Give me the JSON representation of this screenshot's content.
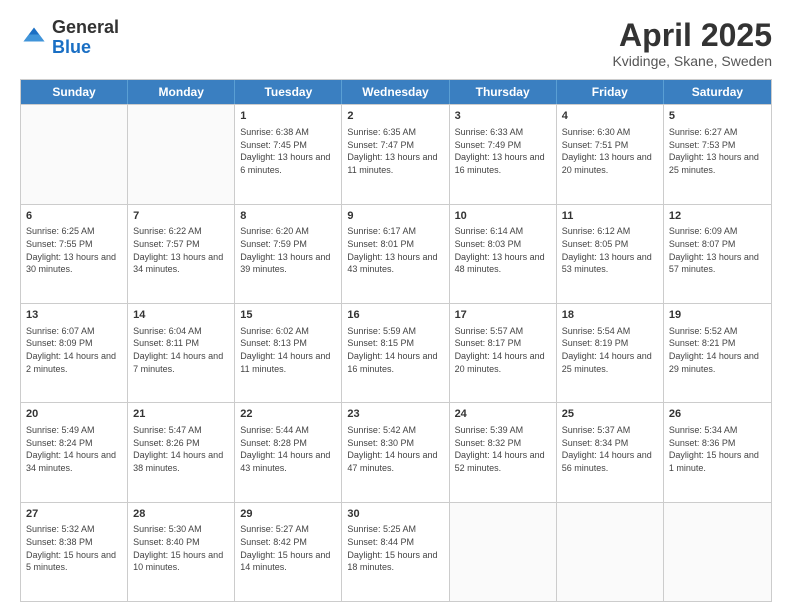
{
  "header": {
    "logo_general": "General",
    "logo_blue": "Blue",
    "month_title": "April 2025",
    "subtitle": "Kvidinge, Skane, Sweden"
  },
  "weekdays": [
    "Sunday",
    "Monday",
    "Tuesday",
    "Wednesday",
    "Thursday",
    "Friday",
    "Saturday"
  ],
  "weeks": [
    [
      {
        "day": "",
        "info": ""
      },
      {
        "day": "",
        "info": ""
      },
      {
        "day": "1",
        "info": "Sunrise: 6:38 AM\nSunset: 7:45 PM\nDaylight: 13 hours and 6 minutes."
      },
      {
        "day": "2",
        "info": "Sunrise: 6:35 AM\nSunset: 7:47 PM\nDaylight: 13 hours and 11 minutes."
      },
      {
        "day": "3",
        "info": "Sunrise: 6:33 AM\nSunset: 7:49 PM\nDaylight: 13 hours and 16 minutes."
      },
      {
        "day": "4",
        "info": "Sunrise: 6:30 AM\nSunset: 7:51 PM\nDaylight: 13 hours and 20 minutes."
      },
      {
        "day": "5",
        "info": "Sunrise: 6:27 AM\nSunset: 7:53 PM\nDaylight: 13 hours and 25 minutes."
      }
    ],
    [
      {
        "day": "6",
        "info": "Sunrise: 6:25 AM\nSunset: 7:55 PM\nDaylight: 13 hours and 30 minutes."
      },
      {
        "day": "7",
        "info": "Sunrise: 6:22 AM\nSunset: 7:57 PM\nDaylight: 13 hours and 34 minutes."
      },
      {
        "day": "8",
        "info": "Sunrise: 6:20 AM\nSunset: 7:59 PM\nDaylight: 13 hours and 39 minutes."
      },
      {
        "day": "9",
        "info": "Sunrise: 6:17 AM\nSunset: 8:01 PM\nDaylight: 13 hours and 43 minutes."
      },
      {
        "day": "10",
        "info": "Sunrise: 6:14 AM\nSunset: 8:03 PM\nDaylight: 13 hours and 48 minutes."
      },
      {
        "day": "11",
        "info": "Sunrise: 6:12 AM\nSunset: 8:05 PM\nDaylight: 13 hours and 53 minutes."
      },
      {
        "day": "12",
        "info": "Sunrise: 6:09 AM\nSunset: 8:07 PM\nDaylight: 13 hours and 57 minutes."
      }
    ],
    [
      {
        "day": "13",
        "info": "Sunrise: 6:07 AM\nSunset: 8:09 PM\nDaylight: 14 hours and 2 minutes."
      },
      {
        "day": "14",
        "info": "Sunrise: 6:04 AM\nSunset: 8:11 PM\nDaylight: 14 hours and 7 minutes."
      },
      {
        "day": "15",
        "info": "Sunrise: 6:02 AM\nSunset: 8:13 PM\nDaylight: 14 hours and 11 minutes."
      },
      {
        "day": "16",
        "info": "Sunrise: 5:59 AM\nSunset: 8:15 PM\nDaylight: 14 hours and 16 minutes."
      },
      {
        "day": "17",
        "info": "Sunrise: 5:57 AM\nSunset: 8:17 PM\nDaylight: 14 hours and 20 minutes."
      },
      {
        "day": "18",
        "info": "Sunrise: 5:54 AM\nSunset: 8:19 PM\nDaylight: 14 hours and 25 minutes."
      },
      {
        "day": "19",
        "info": "Sunrise: 5:52 AM\nSunset: 8:21 PM\nDaylight: 14 hours and 29 minutes."
      }
    ],
    [
      {
        "day": "20",
        "info": "Sunrise: 5:49 AM\nSunset: 8:24 PM\nDaylight: 14 hours and 34 minutes."
      },
      {
        "day": "21",
        "info": "Sunrise: 5:47 AM\nSunset: 8:26 PM\nDaylight: 14 hours and 38 minutes."
      },
      {
        "day": "22",
        "info": "Sunrise: 5:44 AM\nSunset: 8:28 PM\nDaylight: 14 hours and 43 minutes."
      },
      {
        "day": "23",
        "info": "Sunrise: 5:42 AM\nSunset: 8:30 PM\nDaylight: 14 hours and 47 minutes."
      },
      {
        "day": "24",
        "info": "Sunrise: 5:39 AM\nSunset: 8:32 PM\nDaylight: 14 hours and 52 minutes."
      },
      {
        "day": "25",
        "info": "Sunrise: 5:37 AM\nSunset: 8:34 PM\nDaylight: 14 hours and 56 minutes."
      },
      {
        "day": "26",
        "info": "Sunrise: 5:34 AM\nSunset: 8:36 PM\nDaylight: 15 hours and 1 minute."
      }
    ],
    [
      {
        "day": "27",
        "info": "Sunrise: 5:32 AM\nSunset: 8:38 PM\nDaylight: 15 hours and 5 minutes."
      },
      {
        "day": "28",
        "info": "Sunrise: 5:30 AM\nSunset: 8:40 PM\nDaylight: 15 hours and 10 minutes."
      },
      {
        "day": "29",
        "info": "Sunrise: 5:27 AM\nSunset: 8:42 PM\nDaylight: 15 hours and 14 minutes."
      },
      {
        "day": "30",
        "info": "Sunrise: 5:25 AM\nSunset: 8:44 PM\nDaylight: 15 hours and 18 minutes."
      },
      {
        "day": "",
        "info": ""
      },
      {
        "day": "",
        "info": ""
      },
      {
        "day": "",
        "info": ""
      }
    ]
  ]
}
